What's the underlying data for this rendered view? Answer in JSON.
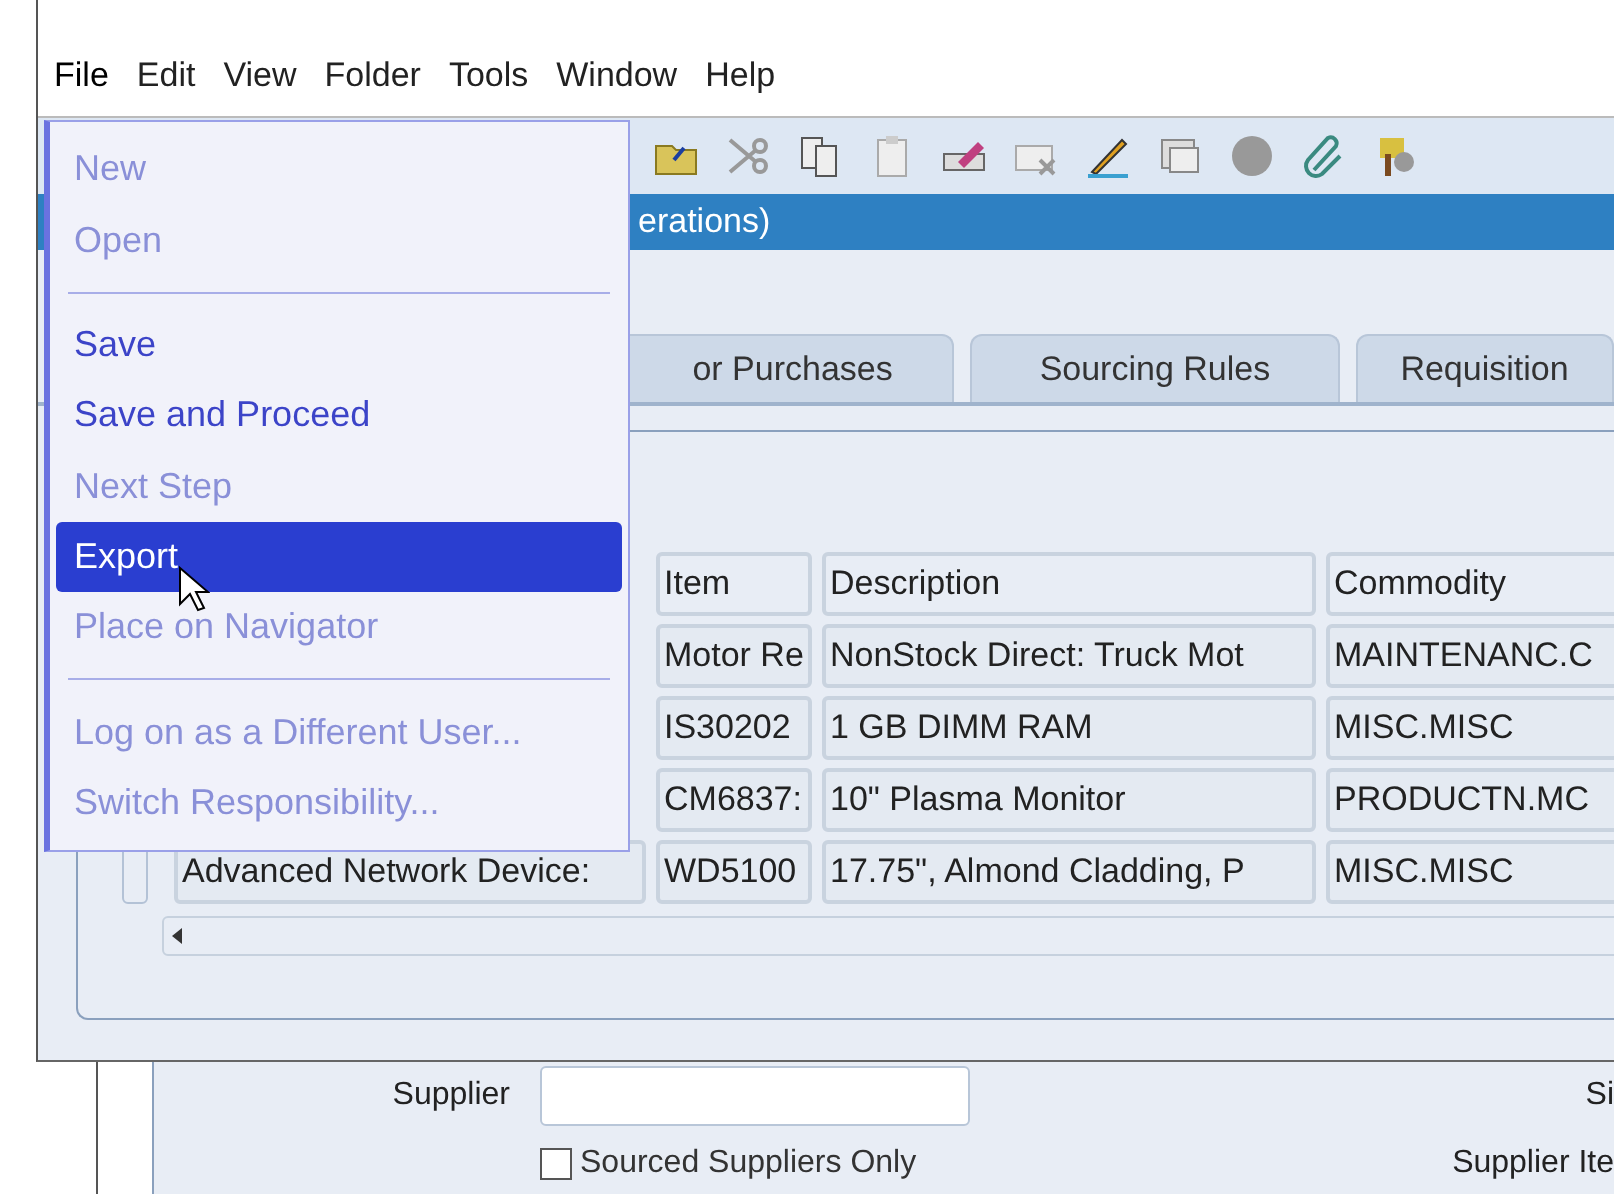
{
  "menubar": [
    {
      "label": "File",
      "selected": true
    },
    {
      "label": "Edit",
      "selected": false
    },
    {
      "label": "View",
      "selected": false
    },
    {
      "label": "Folder",
      "selected": false
    },
    {
      "label": "Tools",
      "selected": false
    },
    {
      "label": "Window",
      "selected": false
    },
    {
      "label": "Help",
      "selected": false
    }
  ],
  "file_menu": [
    {
      "kind": "item",
      "label": "New",
      "disabled": true,
      "selected": false
    },
    {
      "kind": "item",
      "label": "Open",
      "disabled": true,
      "selected": false
    },
    {
      "kind": "separator"
    },
    {
      "kind": "item",
      "label": "Save",
      "disabled": false,
      "selected": false
    },
    {
      "kind": "item",
      "label": "Save and Proceed",
      "disabled": false,
      "selected": false
    },
    {
      "kind": "item",
      "label": "Next Step",
      "disabled": true,
      "selected": false
    },
    {
      "kind": "item",
      "label": "Export",
      "disabled": false,
      "selected": true
    },
    {
      "kind": "item",
      "label": "Place on Navigator",
      "disabled": true,
      "selected": false
    },
    {
      "kind": "separator"
    },
    {
      "kind": "item",
      "label": "Log on as a Different User...",
      "disabled": true,
      "selected": false
    },
    {
      "kind": "item",
      "label": "Switch Responsibility...",
      "disabled": true,
      "selected": false
    }
  ],
  "window": {
    "title": "erations)"
  },
  "tabs": [
    {
      "label": "or Purchases",
      "selected": false
    },
    {
      "label": "Sourcing Rules",
      "selected": false
    },
    {
      "label": "Requisition",
      "selected": false
    }
  ],
  "table": {
    "columns": [
      "Item",
      "Description",
      "Commodity"
    ],
    "rows": [
      {
        "item": "Motor Re",
        "description": "NonStock Direct: Truck Mot",
        "commodity": "MAINTENANC.C"
      },
      {
        "item": "IS30202",
        "description": "1 GB DIMM RAM",
        "commodity": "MISC.MISC"
      },
      {
        "item": "CM6837:",
        "description": "10\" Plasma Monitor",
        "commodity": "PRODUCTN.MC"
      },
      {
        "name": "Advanced Network Device:",
        "item": "WD5100",
        "description": "17.75\", Almond Cladding, P",
        "commodity": "MISC.MISC"
      }
    ]
  },
  "form": {
    "supplier_label": "Supplier",
    "site_label": "Si",
    "sourced_only": {
      "label": "Sourced Suppliers Only",
      "checked": false
    },
    "supplier_item_label": "Supplier Ite"
  }
}
